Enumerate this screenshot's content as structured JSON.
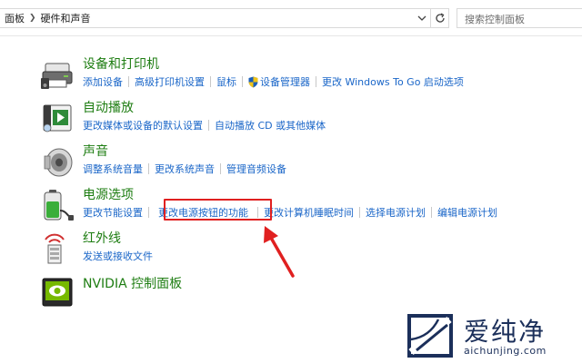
{
  "breadcrumb": {
    "items": [
      "面板",
      "硬件和声音"
    ]
  },
  "search": {
    "placeholder": "搜索控制面板"
  },
  "categories": [
    {
      "title": "设备和打印机",
      "icon": "printer-icon",
      "links": [
        "添加设备",
        "高级打印机设置",
        "鼠标",
        "设备管理器",
        "更改 Windows To Go 启动选项"
      ]
    },
    {
      "title": "自动播放",
      "icon": "autoplay-icon",
      "links": [
        "更改媒体或设备的默认设置",
        "自动播放 CD 或其他媒体"
      ]
    },
    {
      "title": "声音",
      "icon": "speaker-icon",
      "links": [
        "调整系统音量",
        "更改系统声音",
        "管理音频设备"
      ]
    },
    {
      "title": "电源选项",
      "icon": "battery-icon",
      "links": [
        "更改节能设置",
        "更改电源按钮的功能",
        "更改计算机睡眠时间",
        "选择电源计划",
        "编辑电源计划"
      ]
    },
    {
      "title": "红外线",
      "icon": "infrared-icon",
      "links": [
        "发送或接收文件"
      ]
    },
    {
      "title": "NVIDIA 控制面板",
      "icon": "nvidia-icon",
      "links": []
    }
  ],
  "watermark": {
    "text": "爱纯净",
    "url": "aichunjing.com"
  },
  "colors": {
    "title": "#1e7d12",
    "link": "#1a66c8",
    "highlight": "#e02020",
    "watermark": "#1b2f5a"
  }
}
